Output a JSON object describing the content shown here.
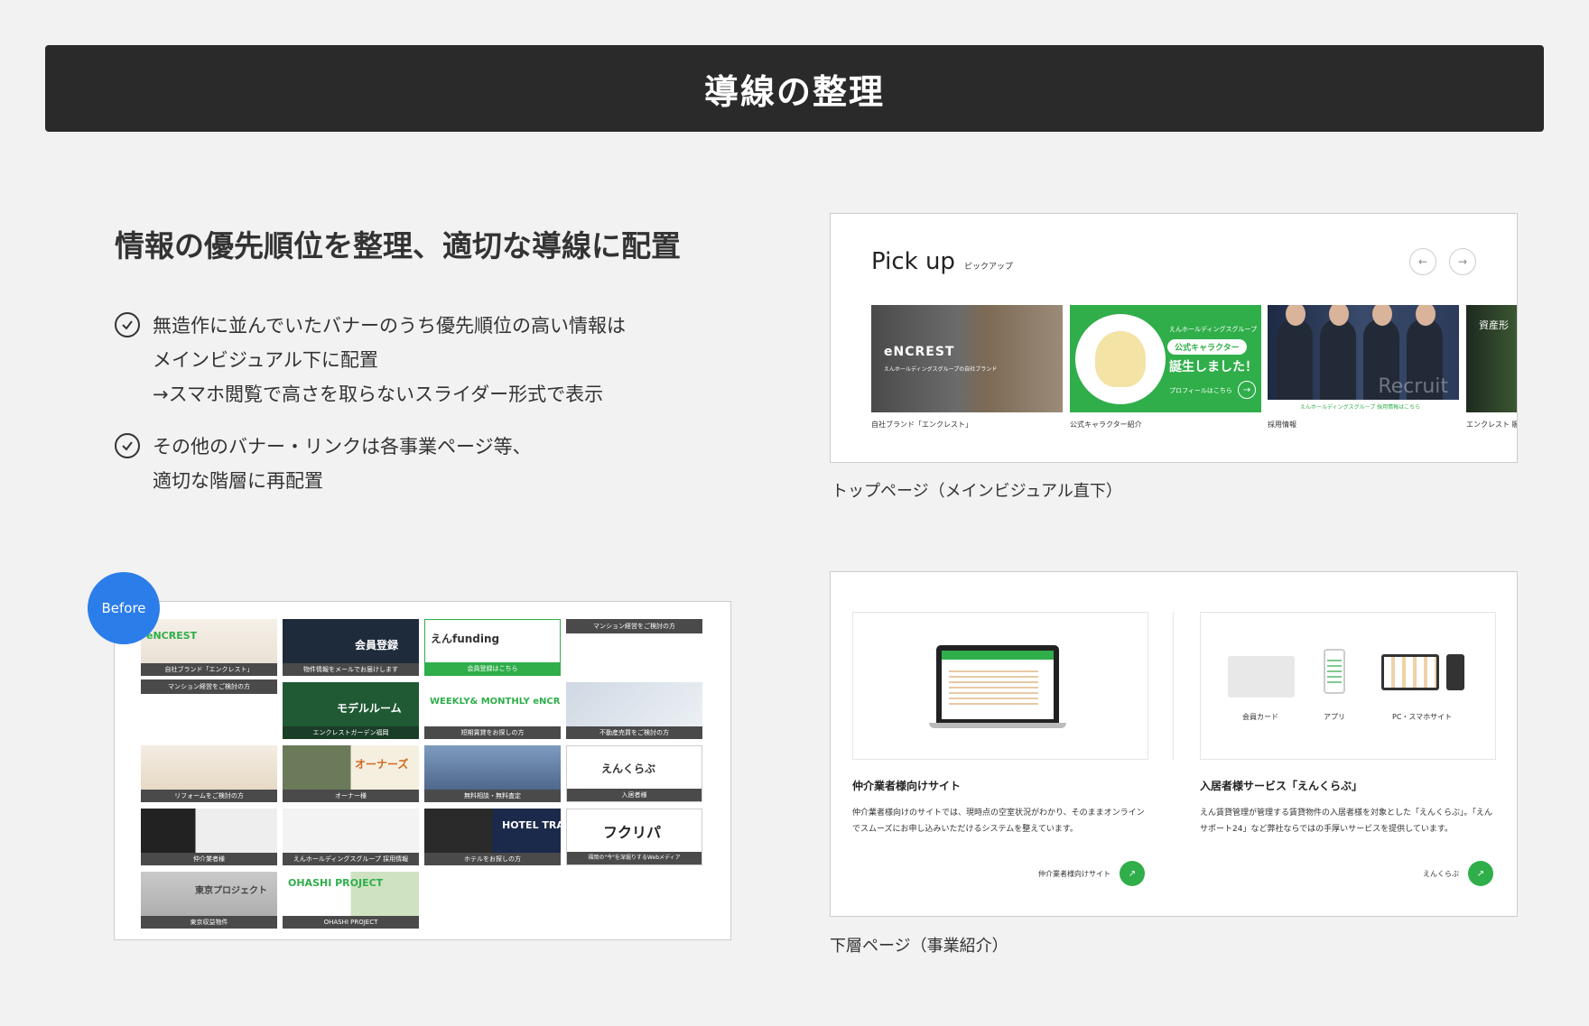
{
  "header": {
    "title": "導線の整理"
  },
  "headline": "情報の優先順位を整理、適切な導線に配置",
  "points": [
    {
      "lines": [
        "無造作に並んでいたバナーのうち優先順位の高い情報は",
        "メインビジュアル下に配置",
        "→スマホ閲覧で高さを取らないスライダー形式で表示"
      ]
    },
    {
      "lines": [
        "その他のバナー・リンクは各事業ページ等、",
        "適切な階層に再配置"
      ]
    }
  ],
  "pickup": {
    "title": "Pick up",
    "title_kana": "ピックアップ",
    "cards": [
      {
        "logo": "eNCREST",
        "sub": "えんホールディングスグループの自社ブランド",
        "caption": "自社ブランド「エンクレスト」"
      },
      {
        "small": "えんホールディングスグループ",
        "pill": "公式キャラクター",
        "big": "誕生しました！",
        "link": "プロフィールはこちら",
        "caption": "公式キャラクター紹介"
      },
      {
        "overlay": "Recruit",
        "bar": "えんホールディングスグループ 採用情報はこちら",
        "caption": "採用情報"
      },
      {
        "text": "資産形",
        "caption": "エンクレスト 販"
      }
    ],
    "panel_caption": "トップページ（メインビジュアル直下）"
  },
  "before": {
    "badge": "Before",
    "banners": [
      {
        "main": "eNCREST",
        "label": "自社ブランド「エンクレスト」"
      },
      {
        "main": "会員登録",
        "label": "物件情報をメールでお届けします"
      },
      {
        "main": "えんfunding",
        "label": "会員登録はこちら"
      },
      {
        "main": "",
        "label": "マンション経営をご検討の方"
      },
      {
        "main": "",
        "label": "マンション経営をご検討の方"
      },
      {
        "main": "モデルルーム",
        "label": "エンクレストガーデン福岡"
      },
      {
        "main": "WEEKLY& MONTHLY eNCREST",
        "label": "短期賃貸をお探しの方"
      },
      {
        "main": "",
        "label": "不動産売買をご検討の方"
      },
      {
        "main": "",
        "label": "リフォームをご検討の方"
      },
      {
        "main": "オーナーズ",
        "label": "オーナー様"
      },
      {
        "main": "",
        "label": "無料相談・無料査定"
      },
      {
        "main": "えんくらぶ",
        "label": "入居者様"
      },
      {
        "main": "",
        "label": "仲介業者様"
      },
      {
        "main": "",
        "label": "えんホールディングスグループ 採用情報"
      },
      {
        "main": "HOTEL TRAD",
        "label": "ホテルをお探しの方"
      },
      {
        "main": "フクリパ",
        "label": "福岡の\"今\"を深堀りするWebメディア"
      },
      {
        "main": "東京プロジェクト",
        "label": "東京収益物件"
      },
      {
        "main": "OHASHI PROJECT",
        "label": "OHASHI PROJECT"
      }
    ]
  },
  "lower": {
    "left": {
      "title": "仲介業者様向けサイト",
      "desc": "仲介業者様向けのサイトでは、現時点の空室状況がわかり、そのままオンラインでスムーズにお申し込みいただけるシステムを整えています。",
      "link": "仲介業者様向けサイト"
    },
    "right": {
      "icons": [
        "会員カード",
        "アプリ",
        "PC・スマホサイト"
      ],
      "title": "入居者様サービス「えんくらぶ」",
      "desc": "えん賃貸管理が管理する賃貸物件の入居者様を対象とした「えんくらぶ」。「えんサポート24」など弊社ならではの手厚いサービスを提供しています。",
      "link": "えんくらぶ"
    },
    "panel_caption": "下層ページ（事業紹介）"
  },
  "colors": {
    "accent_green": "#2fae4a",
    "badge_blue": "#2b7de9",
    "title_bar": "#2a2a2a"
  }
}
